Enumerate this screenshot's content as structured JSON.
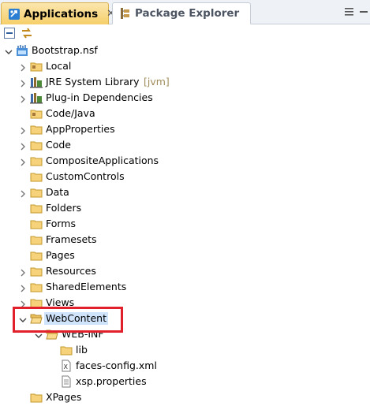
{
  "tabs": [
    {
      "label": "Applications",
      "icon": "applications-icon",
      "close": "✕",
      "active": true
    },
    {
      "label": "Package Explorer",
      "icon": "package-explorer-icon",
      "close": "",
      "active": false
    }
  ],
  "toolbar": {
    "collapse_icon": "collapse-all-icon",
    "link_icon": "link-with-editor-icon"
  },
  "tree": [
    {
      "label": "Bootstrap.nsf",
      "decoration": "",
      "icon": "nsf-project-icon",
      "depth": 0,
      "twisty": "expanded"
    },
    {
      "label": "Local",
      "decoration": "",
      "icon": "package-folder-icon",
      "depth": 1,
      "twisty": "collapsed"
    },
    {
      "label": "JRE System Library",
      "decoration": "[jvm]",
      "icon": "library-icon",
      "depth": 1,
      "twisty": "collapsed"
    },
    {
      "label": "Plug-in Dependencies",
      "decoration": "",
      "icon": "library-icon",
      "depth": 1,
      "twisty": "collapsed"
    },
    {
      "label": "Code/Java",
      "decoration": "",
      "icon": "package-folder-icon",
      "depth": 1,
      "twisty": "none"
    },
    {
      "label": "AppProperties",
      "decoration": "",
      "icon": "folder-icon",
      "depth": 1,
      "twisty": "collapsed"
    },
    {
      "label": "Code",
      "decoration": "",
      "icon": "folder-icon",
      "depth": 1,
      "twisty": "collapsed"
    },
    {
      "label": "CompositeApplications",
      "decoration": "",
      "icon": "folder-icon",
      "depth": 1,
      "twisty": "collapsed"
    },
    {
      "label": "CustomControls",
      "decoration": "",
      "icon": "folder-icon",
      "depth": 1,
      "twisty": "none"
    },
    {
      "label": "Data",
      "decoration": "",
      "icon": "folder-icon",
      "depth": 1,
      "twisty": "collapsed"
    },
    {
      "label": "Folders",
      "decoration": "",
      "icon": "folder-icon",
      "depth": 1,
      "twisty": "none"
    },
    {
      "label": "Forms",
      "decoration": "",
      "icon": "folder-icon",
      "depth": 1,
      "twisty": "none"
    },
    {
      "label": "Framesets",
      "decoration": "",
      "icon": "folder-icon",
      "depth": 1,
      "twisty": "none"
    },
    {
      "label": "Pages",
      "decoration": "",
      "icon": "folder-icon",
      "depth": 1,
      "twisty": "none"
    },
    {
      "label": "Resources",
      "decoration": "",
      "icon": "folder-icon",
      "depth": 1,
      "twisty": "collapsed"
    },
    {
      "label": "SharedElements",
      "decoration": "",
      "icon": "folder-icon",
      "depth": 1,
      "twisty": "collapsed"
    },
    {
      "label": "Views",
      "decoration": "",
      "icon": "folder-icon",
      "depth": 1,
      "twisty": "collapsed"
    },
    {
      "label": "WebContent",
      "decoration": "",
      "icon": "folder-open-icon",
      "depth": 1,
      "twisty": "expanded",
      "selected": true
    },
    {
      "label": "WEB-INF",
      "decoration": "",
      "icon": "folder-open-icon",
      "depth": 2,
      "twisty": "expanded"
    },
    {
      "label": "lib",
      "decoration": "",
      "icon": "folder-icon",
      "depth": 3,
      "twisty": "none"
    },
    {
      "label": "faces-config.xml",
      "decoration": "",
      "icon": "xml-file-icon",
      "depth": 3,
      "twisty": "none"
    },
    {
      "label": "xsp.properties",
      "decoration": "",
      "icon": "properties-file-icon",
      "depth": 3,
      "twisty": "none"
    },
    {
      "label": "XPages",
      "decoration": "",
      "icon": "folder-icon",
      "depth": 1,
      "twisty": "none"
    }
  ],
  "colors": {
    "selection": "#cfe3fb",
    "annotation_box": "#e2202b",
    "active_tab": "#f6cf6a"
  }
}
